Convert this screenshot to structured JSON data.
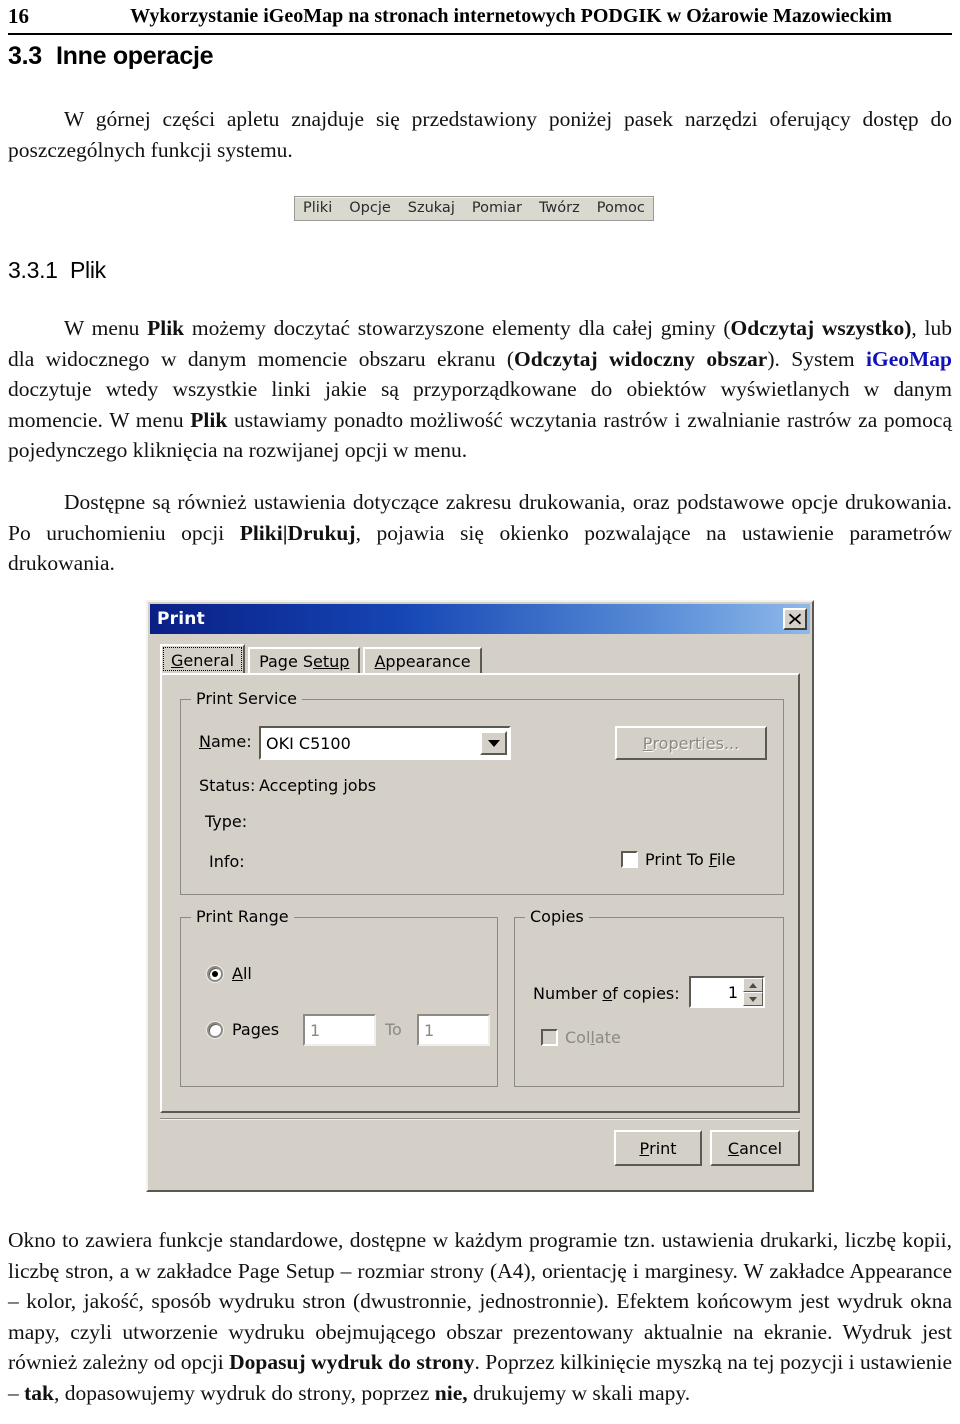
{
  "header": {
    "folio": "16",
    "title": "Wykorzystanie iGeoMap na stronach internetowych PODGIK w Ożarowie Mazowieckim"
  },
  "headings": {
    "section_number": "3.3",
    "section_title": "Inne operacje",
    "subsection_number": "3.3.1",
    "subsection_title": "Plik"
  },
  "paragraphs": {
    "intro_a": "W górnej części apletu znajduje się przedstawiony poniżej pasek narzędzi oferujący dostęp do poszczególnych funkcji systemu.",
    "plik_1": "W menu ",
    "plik_b1": "Plik",
    "plik_2": " możemy doczytać stowarzyszone elementy dla całej gminy (",
    "plik_b2": "Odczytaj wszystko)",
    "plik_3": ", lub dla widocznego w danym momencie obszaru ekranu (",
    "plik_b3": "Odczytaj widoczny obszar",
    "plik_4": "). System ",
    "plik_brand": "iGeoMap",
    "plik_5": " doczytuje wtedy wszystkie linki jakie są przyporządkowane do obiektów wyświetlanych w danym momencie. W menu ",
    "plik_b4": "Plik",
    "plik_6": " ustawiamy ponadto możliwość wczytania rastrów i zwalnianie rastrów za pomocą pojedynczego kliknięcia na rozwijanej opcji w menu.",
    "druk_1": "Dostępne są również ustawienia dotyczące zakresu drukowania, oraz podstawowe opcje drukowania. Po uruchomieniu opcji ",
    "druk_b1": "Pliki|Drukuj",
    "druk_2": ", pojawia się okienko pozwalające na ustawienie parametrów drukowania.",
    "okno_1": "Okno to zawiera funkcje standardowe, dostępne w każdym programie tzn. ustawienia drukarki, liczbę kopii, liczbę stron, a w zakładce Page Setup – rozmiar strony (A4), orientację i marginesy. W zakładce Appearance – kolor, jakość, sposób wydruku stron (dwustronnie, jednostronnie). Efektem końcowym jest wydruk okna mapy, czyli utworzenie wydruku obejmującego obszar prezentowany aktualnie na ekranie. Wydruk jest również zależny od opcji ",
    "okno_b1": "Dopasuj wydruk do strony",
    "okno_2": ". Poprzez kilkinięcie myszką na tej pozycji i ustawienie – ",
    "okno_b2": "tak",
    "okno_3": ", dopasowujemy wydruk do strony, poprzez ",
    "okno_b3": "nie,",
    "okno_4": " drukujemy w skali mapy."
  },
  "applet_toolbar": {
    "items": [
      "Pliki",
      "Opcje",
      "Szukaj",
      "Pomiar",
      "Twórz",
      "Pomoc"
    ]
  },
  "print_dialog": {
    "title": "Print",
    "close_icon": "close-icon",
    "tabs": [
      {
        "label_a": "G",
        "label_b": "eneral",
        "active": true
      },
      {
        "label_a": "Page S",
        "label_b": "etup",
        "active": false
      },
      {
        "label_a": "A",
        "label_b": "ppearance",
        "active": false
      }
    ],
    "tab_general": "General",
    "tab_page_setup": "Page Setup",
    "tab_appearance": "Appearance",
    "print_service": {
      "group_title": "Print Service",
      "name_label_u": "N",
      "name_label_rest": "ame:",
      "name_value": "OKI C5100",
      "dropdown_icon": "chevron-down-icon",
      "properties_label_u": "P",
      "properties_label_rest": "roperties...",
      "status_label": "Status:",
      "status_value": "Accepting jobs",
      "type_label": "Type:",
      "type_value": "",
      "info_label": "Info:",
      "info_value": "",
      "print_to_file_pre": "Print To ",
      "print_to_file_u": "F",
      "print_to_file_post": "ile",
      "print_to_file_checked": false
    },
    "print_range": {
      "group_title": "Print Range",
      "all_u": "A",
      "all_rest": "ll",
      "all_selected": true,
      "pages_pre": "Pa",
      "pages_u": "g",
      "pages_post": "es",
      "pages_selected": false,
      "from_value": "1",
      "to_label": "To",
      "to_value": "1"
    },
    "copies": {
      "group_title": "Copies",
      "number_pre": "Number ",
      "number_u": "o",
      "number_post": "f copies:",
      "number_value": "1",
      "spinner_up_icon": "spinner-up-icon",
      "spinner_down_icon": "spinner-down-icon",
      "collate_pre": "Col",
      "collate_u": "l",
      "collate_post": "ate",
      "collate_checked": false,
      "collate_enabled": false
    },
    "buttons": {
      "print_u": "P",
      "print_rest": "rint",
      "cancel_u": "C",
      "cancel_rest": "ancel"
    }
  },
  "colors": {
    "titlebar_start": "#0a1f86",
    "titlebar_end": "#8fb9ea",
    "dialog_face": "#d4d0c8",
    "brand_blue": "#1111bb",
    "toolbar_face": "#d9d9d0"
  }
}
